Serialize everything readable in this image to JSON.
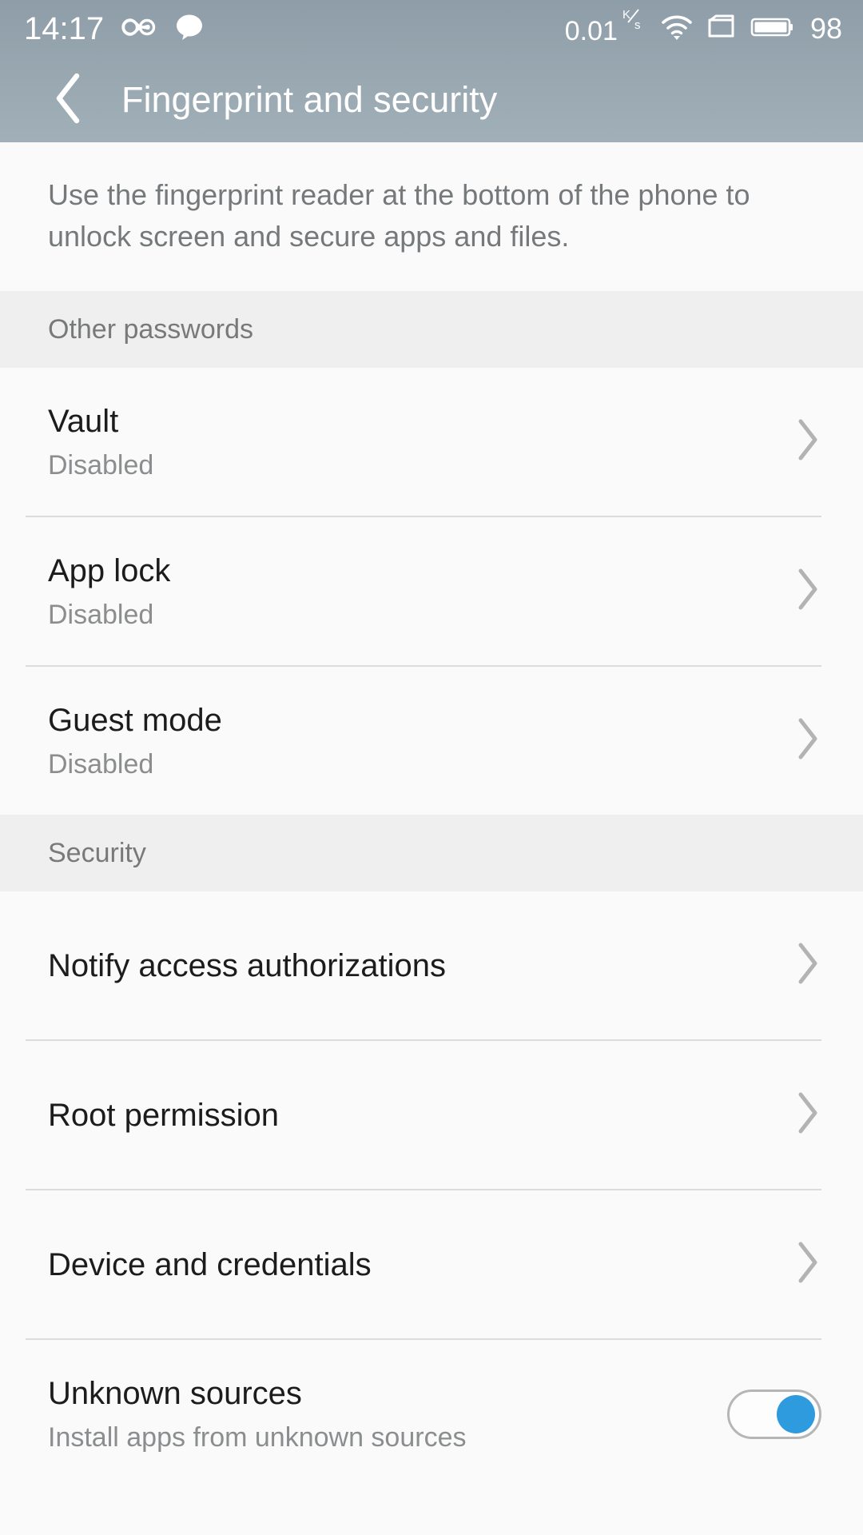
{
  "status_bar": {
    "clock": "14:17",
    "icons_left": [
      "infinity-icon",
      "message-bubble-icon"
    ],
    "network_speed": "0.01",
    "network_speed_unit_top": "K",
    "network_speed_unit_bottom": "s",
    "icons_right": [
      "wifi-icon",
      "sim-card-icon",
      "battery-icon"
    ],
    "battery_level": "98"
  },
  "app_bar": {
    "back_icon": "chevron-left-icon",
    "title": "Fingerprint and security"
  },
  "intro": {
    "text": "Use the fingerprint reader at the bottom of the phone to unlock screen and secure apps and files."
  },
  "sections": [
    {
      "header": "Other passwords",
      "items": [
        {
          "title": "Vault",
          "subtitle": "Disabled",
          "accessory": "chevron"
        },
        {
          "title": "App lock",
          "subtitle": "Disabled",
          "accessory": "chevron"
        },
        {
          "title": "Guest mode",
          "subtitle": "Disabled",
          "accessory": "chevron"
        }
      ]
    },
    {
      "header": "Security",
      "items": [
        {
          "title": "Notify access authorizations",
          "subtitle": "",
          "accessory": "chevron"
        },
        {
          "title": "Root permission",
          "subtitle": "",
          "accessory": "chevron"
        },
        {
          "title": "Device and credentials",
          "subtitle": "",
          "accessory": "chevron"
        },
        {
          "title": "Unknown sources",
          "subtitle": "Install apps from unknown sources",
          "accessory": "toggle",
          "toggle_on": true
        }
      ]
    }
  ],
  "colors": {
    "header_bg_top": "#8e9da8",
    "header_bg_bottom": "#a1b0b8",
    "content_bg": "#fafafa",
    "section_header_bg": "#efefef",
    "divider": "#dcdcdc",
    "title_text": "#1c1c1c",
    "secondary_text": "#8b8d8e",
    "toggle_on_accent": "#2f9bdf"
  }
}
